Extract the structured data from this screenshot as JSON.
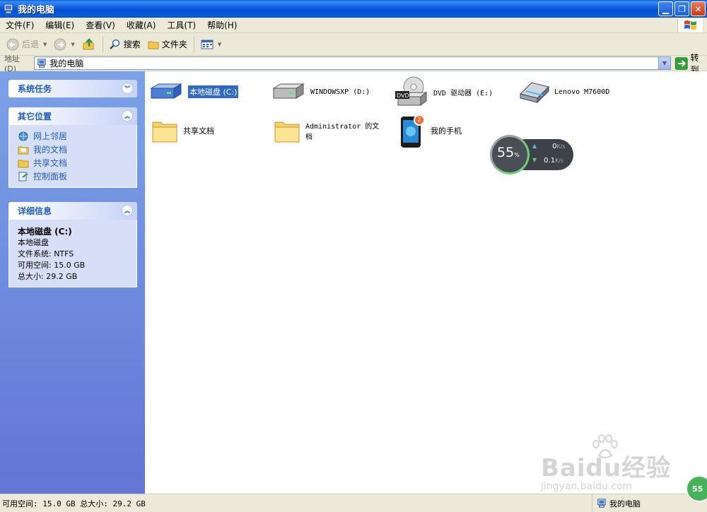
{
  "window": {
    "title": "我的电脑"
  },
  "menu": [
    "文件(F)",
    "编辑(E)",
    "查看(V)",
    "收藏(A)",
    "工具(T)",
    "帮助(H)"
  ],
  "toolbar": {
    "back": "后退",
    "search": "搜索",
    "folders": "文件夹"
  },
  "address": {
    "label": "地址(D)",
    "value": "我的电脑",
    "go": "转到"
  },
  "sidebar": {
    "system_tasks": {
      "title": "系统任务"
    },
    "other_places": {
      "title": "其它位置",
      "items": [
        "网上邻居",
        "我的文档",
        "共享文档",
        "控制面板"
      ]
    },
    "details": {
      "title": "详细信息",
      "name": "本地磁盘 (C:)",
      "type": "本地磁盘",
      "fs": "文件系统: NTFS",
      "free": "可用空间: 15.0 GB",
      "total": "总大小: 29.2 GB"
    }
  },
  "items": {
    "c_drive": "本地磁盘 (C:)",
    "d_drive": "WINDOWSXP (D:)",
    "dvd_drive": "DVD 驱动器 (E:)",
    "scanner": "Lenovo M7600D",
    "shared_docs": "共享文档",
    "admin_docs": "Administrator 的文档",
    "phone": "我的手机",
    "phone_badge": "2"
  },
  "speed_widget": {
    "percent": "55",
    "percent_unit": "%",
    "up": "0",
    "up_unit": "K/s",
    "down": "0.1",
    "down_unit": "K/s"
  },
  "watermark": {
    "brand": "Baidu经验",
    "url": "jingyan.baidu.com"
  },
  "status": {
    "left": "可用空间: 15.0 GB 总大小: 29.2 GB",
    "right": "我的电脑",
    "badge": "55"
  },
  "colors": {
    "title_bar": "#0a5ed8",
    "sidebar": "#6f8de0",
    "link": "#215dc6",
    "selection": "#316ac5"
  }
}
